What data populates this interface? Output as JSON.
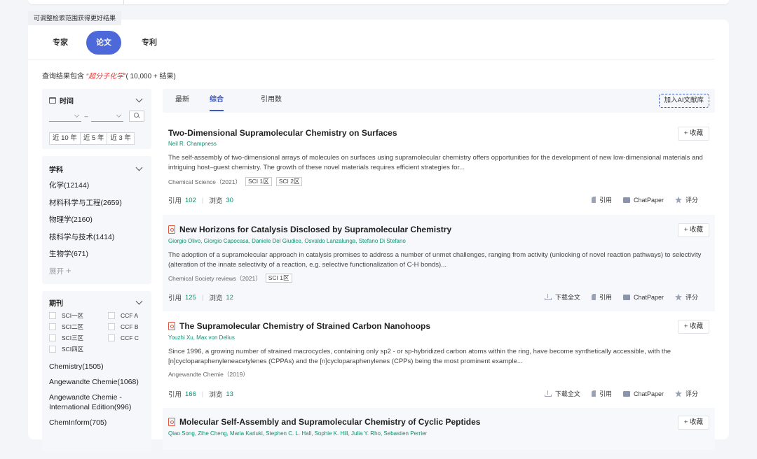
{
  "tooltip": "可调整检索范围获得更好结果",
  "type_tabs": [
    "专家",
    "论文",
    "专利"
  ],
  "summary": {
    "prefix": "查询结果包含 ",
    "keyword": "“超分子化学”",
    "suffix": "( 10,000 + 结果)"
  },
  "filters": {
    "time": {
      "title": "时间",
      "quick": [
        "近 10 年",
        "近 5 年",
        "近 3 年"
      ]
    },
    "subject": {
      "title": "学科",
      "items": [
        "化学(12144)",
        "材料科学与工程(2659)",
        "物理学(2160)",
        "核科学与技术(1414)",
        "生物学(671)"
      ],
      "more": "展开"
    },
    "journal": {
      "title": "期刊",
      "checks": [
        "SCI一区",
        "CCF A",
        "SCI二区",
        "CCF B",
        "SCI三区",
        "CCF C",
        "SCI四区"
      ],
      "items": [
        "Chemistry(1505)",
        "Angewandte Chemie(1068)",
        "Angewandte Chemie - International Edition(996)",
        "ChemInform(705)"
      ]
    }
  },
  "sort": {
    "options": [
      "最新",
      "综合",
      "引用数"
    ],
    "active": "综合",
    "add_library": "加入AI文献库"
  },
  "collect_label": "+ 收藏",
  "action_labels": {
    "download": "下载全文",
    "cite": "引用",
    "chatpaper": "ChatPaper",
    "rate": "评分"
  },
  "stat_labels": {
    "cite": "引用",
    "view": "浏览"
  },
  "papers": [
    {
      "title": "Two‐Dimensional Supramolecular Chemistry on Surfaces",
      "authors": "Neil R. Champness",
      "abstract": "The self-assembly of two-dimensional arrays of molecules on surfaces using supramolecular chemistry offers opportunities for the development of new low-dimensional materials and intriguing host–guest chemistry. The growth of these novel materials requires efficient strategies for...",
      "venue": "Chemical Science（2021）",
      "tags": [
        "SCI 1区",
        "SCI 2区"
      ],
      "citations": "102",
      "views": "30"
    },
    {
      "title": "New Horizons for Catalysis Disclosed by Supramolecular Chemistry",
      "authors": "Giorgio Olivo,  Giorgio Capocasa,  Daniele Del Giudice,  Osvaldo Lanzalunga,  Stefano Di Stefano",
      "abstract": "The adoption of a supramolecular approach in catalysis promises to address a number of unmet challenges, ranging from activity (unlocking of novel reaction pathways) to selectivity (alteration of the innate selectivity of a reaction, e.g. selective functionalization of C-H bonds)...",
      "venue": "Chemical Society reviews（2021）",
      "tags": [
        "SCI 1区"
      ],
      "citations": "125",
      "views": "12"
    },
    {
      "title": "The Supramolecular Chemistry of Strained Carbon Nanohoops",
      "authors": "Youzhi Xu,  Max von Delius",
      "abstract": "Since 1996, a growing number of strained macrocycles, containing only sp2 - or sp-hybridized carbon atoms within the ring, have become synthetically accessible, with the [n]cycloparaphenyleneacetylenes (CPPAs) and the [n]cycloparaphenylenes (CPPs) being the most prominent example...",
      "venue": "Angewandte Chemie（2019）",
      "tags": [],
      "citations": "166",
      "views": "13"
    },
    {
      "title": "Molecular Self-Assembly and Supramolecular Chemistry of Cyclic Peptides",
      "authors": "Qiao Song,  Zihe Cheng,  Maria Kariuki,  Stephen C. L. Hall,  Sophie K. Hill,  Julia Y. Rho,  Sebastien Perrier"
    }
  ]
}
